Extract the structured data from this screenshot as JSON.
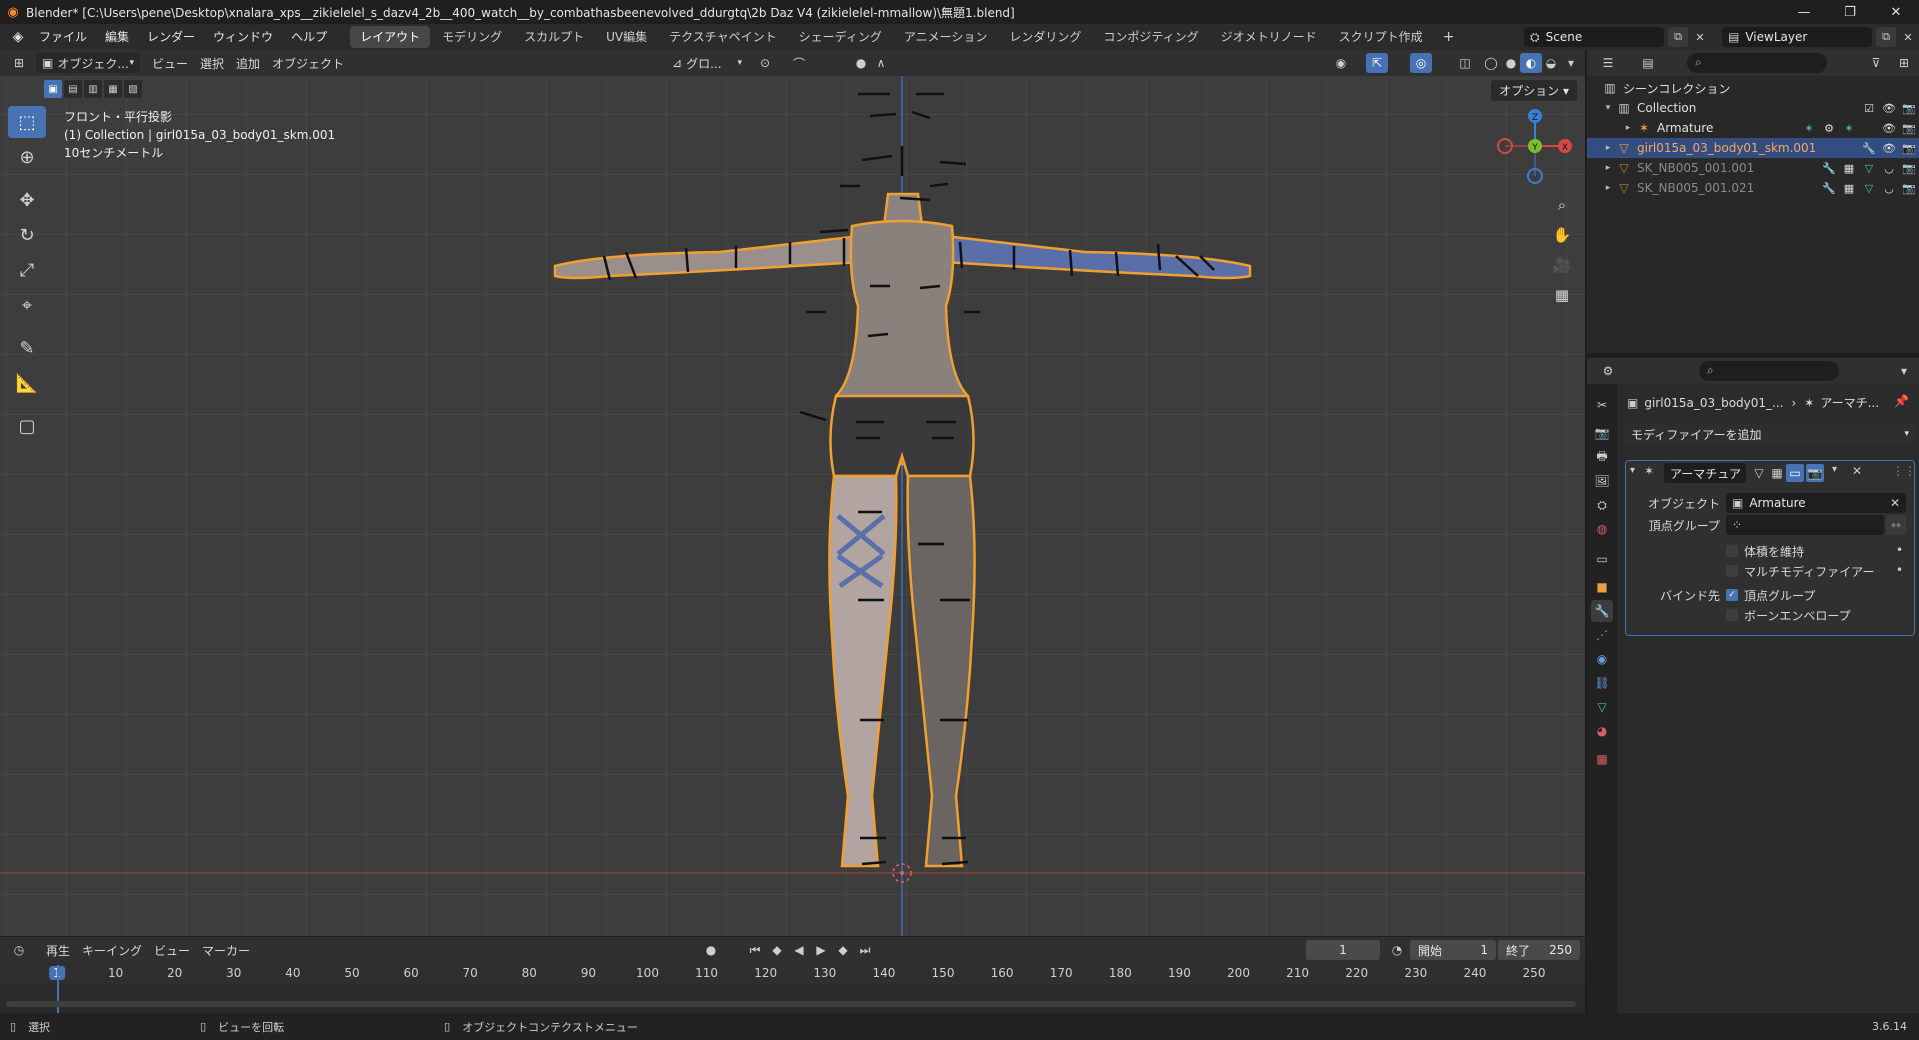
{
  "titlebar": {
    "title": "Blender* [C:\\Users\\pene\\Desktop\\xnalara_xps__zikielelel_s_dazv4_2b__400_watch__by_combathasbeenevolved_ddurgtq\\2b Daz V4 (zikielelel-mmallow)\\無題1.blend]",
    "minimize": "—",
    "maximize": "❐",
    "close": "✕"
  },
  "menubar": {
    "menus": [
      "ファイル",
      "編集",
      "レンダー",
      "ウィンドウ",
      "ヘルプ"
    ],
    "workspaces": [
      "レイアウト",
      "モデリング",
      "スカルプト",
      "UV編集",
      "テクスチャペイント",
      "シェーディング",
      "アニメーション",
      "レンダリング",
      "コンポジティング",
      "ジオメトリノード",
      "スクリプト作成"
    ],
    "active_workspace": 0,
    "add_tab": "+",
    "scene": "Scene",
    "viewlayer": "ViewLayer"
  },
  "viewport_header": {
    "mode": "オブジェク...",
    "menus": [
      "ビュー",
      "選択",
      "追加",
      "オブジェクト"
    ],
    "transform_orientation": "グロ...",
    "options": "オプション"
  },
  "viewport": {
    "view_name": "フロント・平行投影",
    "collection_info": "(1) Collection | girl015a_03_body01_skm.001",
    "scale_info": "10センチメートル",
    "gizmo": {
      "z": "Z",
      "y": "Y",
      "x": "X"
    }
  },
  "timeline": {
    "menus": [
      "再生",
      "キーイング",
      "ビュー",
      "マーカー"
    ],
    "current_frame": "1",
    "start_label": "開始",
    "start": "1",
    "end_label": "終了",
    "end": "250",
    "ruler_labels": [
      "1",
      "10",
      "20",
      "30",
      "40",
      "50",
      "60",
      "70",
      "80",
      "90",
      "100",
      "110",
      "120",
      "130",
      "140",
      "150",
      "160",
      "170",
      "180",
      "190",
      "200",
      "210",
      "220",
      "230",
      "240",
      "250"
    ]
  },
  "statusbar": {
    "select": "選択",
    "rotate": "ビューを回転",
    "context": "オブジェクトコンテクストメニュー",
    "version": "3.6.14"
  },
  "outliner": {
    "scene_collection": "シーンコレクション",
    "rows": [
      {
        "label": "Collection"
      },
      {
        "label": "Armature"
      },
      {
        "label": "girl015a_03_body01_skm.001"
      },
      {
        "label": "SK_NB005_001.001"
      },
      {
        "label": "SK_NB005_001.021"
      }
    ]
  },
  "properties": {
    "breadcrumb_object": "girl015a_03_body01_...",
    "breadcrumb_modifier": "アーマチ...",
    "add_modifier": "モディファイアーを追加",
    "modifier_name": "アーマチュア",
    "object_label": "オブジェクト",
    "object_value": "Armature",
    "vgroup_label": "頂点グループ",
    "vgroup_value": "",
    "preserve_volume": "体積を維持",
    "multi_modifier": "マルチモディファイアー",
    "bind_to_label": "バインド先",
    "bind_vertex_groups": "頂点グループ",
    "bind_bone_envelopes": "ボーンエンベロープ"
  }
}
